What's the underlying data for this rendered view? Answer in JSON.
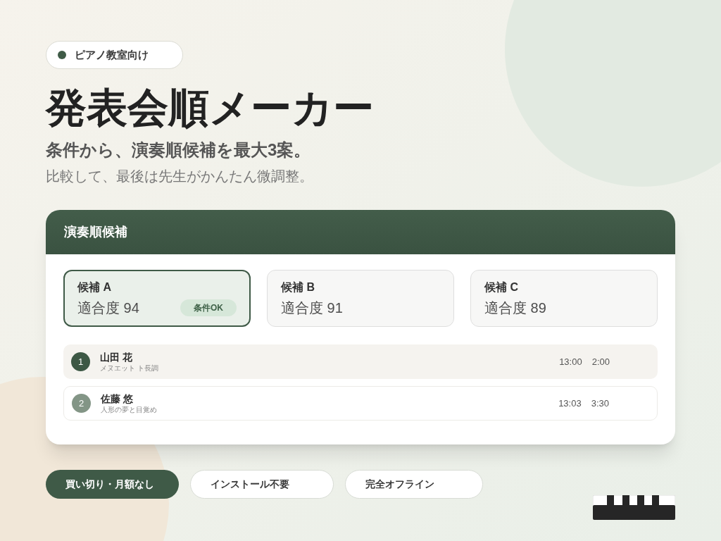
{
  "badge": {
    "label": "ピアノ教室向け"
  },
  "title": "発表会順メーカー",
  "subtitle": "条件から、演奏順候補を最大3案。",
  "description": "比較して、最後は先生がかんたん微調整。",
  "panel": {
    "title": "演奏順候補",
    "candidates": [
      {
        "name": "候補 A",
        "score": "適合度 94",
        "tag": "条件OK",
        "selected": true
      },
      {
        "name": "候補 B",
        "score": "適合度 91",
        "selected": false
      },
      {
        "name": "候補 C",
        "score": "適合度 89",
        "selected": false
      }
    ],
    "rows": [
      {
        "number": "1",
        "name": "山田 花",
        "piece": "メヌエット ト長調",
        "start": "13:00",
        "duration": "2:00",
        "selected": true
      },
      {
        "number": "2",
        "name": "佐藤 悠",
        "piece": "人形の夢と目覚め",
        "start": "13:03",
        "duration": "3:30",
        "selected": false
      }
    ]
  },
  "features": [
    {
      "label": "買い切り・月額なし",
      "selected": true
    },
    {
      "label": "インストール不要",
      "selected": false
    },
    {
      "label": "完全オフライン",
      "selected": false
    }
  ]
}
